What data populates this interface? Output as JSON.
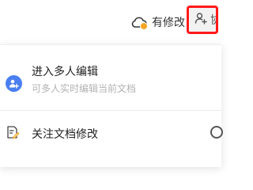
{
  "header": {
    "save_status_label": "有修改",
    "collab_button_partial_label": "协"
  },
  "menu": {
    "multi_edit": {
      "title": "进入多人编辑",
      "subtitle": "可多人实时编辑当前文档"
    },
    "follow": {
      "label": "关注文档修改"
    }
  },
  "icons": {
    "save_status": "cloud-icon",
    "save_badge": "warning-dot",
    "collab": "user-plus-icon",
    "multi_edit": "user-plus-avatar-icon",
    "follow": "document-edit-icon"
  },
  "colors": {
    "highlight_border": "#ff1a1a",
    "badge": "#f5a623",
    "avatar": "#4a7ff0"
  }
}
